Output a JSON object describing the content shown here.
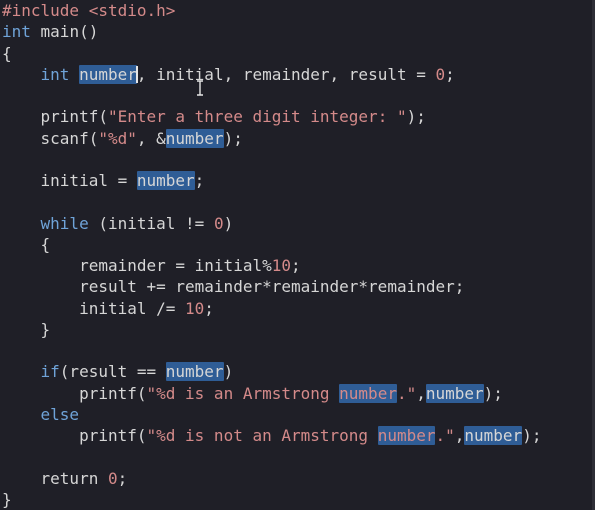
{
  "editor": {
    "colors": {
      "background": "#1f1f27",
      "text": "#d6d6d6",
      "keyword": "#6fa3d8",
      "literal": "#d48a8a",
      "highlight": "#2f5d96"
    },
    "mouse_cursor": "ibeam-cursor-icon",
    "lines": [
      [
        {
          "t": "#include <stdio.h>",
          "c": "pp"
        }
      ],
      [
        {
          "t": "int",
          "c": "kw"
        },
        {
          "t": " main()",
          "c": "pl"
        }
      ],
      [
        {
          "t": "{",
          "c": "pl"
        }
      ],
      [
        {
          "t": "    ",
          "c": "pl"
        },
        {
          "t": "int",
          "c": "kw"
        },
        {
          "t": " ",
          "c": "pl"
        },
        {
          "t": "number",
          "c": "pl",
          "hl": true
        },
        {
          "t": "",
          "c": "pl",
          "cursor": true
        },
        {
          "t": ", initial, remainder, result = ",
          "c": "pl"
        },
        {
          "t": "0",
          "c": "num"
        },
        {
          "t": ";",
          "c": "pl"
        }
      ],
      [],
      [
        {
          "t": "    printf(",
          "c": "pl"
        },
        {
          "t": "\"Enter a three digit integer: \"",
          "c": "str"
        },
        {
          "t": ");",
          "c": "pl"
        }
      ],
      [
        {
          "t": "    scanf(",
          "c": "pl"
        },
        {
          "t": "\"%d\"",
          "c": "str"
        },
        {
          "t": ", &",
          "c": "pl"
        },
        {
          "t": "number",
          "c": "pl",
          "hl": true
        },
        {
          "t": ");",
          "c": "pl"
        }
      ],
      [],
      [
        {
          "t": "    initial = ",
          "c": "pl"
        },
        {
          "t": "number",
          "c": "pl",
          "hl": true
        },
        {
          "t": ";",
          "c": "pl"
        }
      ],
      [],
      [
        {
          "t": "    ",
          "c": "pl"
        },
        {
          "t": "while",
          "c": "kw"
        },
        {
          "t": " (initial != ",
          "c": "pl"
        },
        {
          "t": "0",
          "c": "num"
        },
        {
          "t": ")",
          "c": "pl"
        }
      ],
      [
        {
          "t": "    {",
          "c": "pl"
        }
      ],
      [
        {
          "t": "        remainder = initial%",
          "c": "pl"
        },
        {
          "t": "10",
          "c": "num"
        },
        {
          "t": ";",
          "c": "pl"
        }
      ],
      [
        {
          "t": "        result += remainder*remainder*remainder;",
          "c": "pl"
        }
      ],
      [
        {
          "t": "        initial /= ",
          "c": "pl"
        },
        {
          "t": "10",
          "c": "num"
        },
        {
          "t": ";",
          "c": "pl"
        }
      ],
      [
        {
          "t": "    }",
          "c": "pl"
        }
      ],
      [],
      [
        {
          "t": "    ",
          "c": "pl"
        },
        {
          "t": "if",
          "c": "kw"
        },
        {
          "t": "(result == ",
          "c": "pl"
        },
        {
          "t": "number",
          "c": "pl",
          "hl": true
        },
        {
          "t": ")",
          "c": "pl"
        }
      ],
      [
        {
          "t": "        printf(",
          "c": "pl"
        },
        {
          "t": "\"%d is an Armstrong ",
          "c": "str"
        },
        {
          "t": "number",
          "c": "str",
          "hl": true
        },
        {
          "t": ".\"",
          "c": "str"
        },
        {
          "t": ",",
          "c": "pl"
        },
        {
          "t": "number",
          "c": "pl",
          "hl": true
        },
        {
          "t": ");",
          "c": "pl"
        }
      ],
      [
        {
          "t": "    ",
          "c": "pl"
        },
        {
          "t": "else",
          "c": "kw"
        }
      ],
      [
        {
          "t": "        printf(",
          "c": "pl"
        },
        {
          "t": "\"%d is not an Armstrong ",
          "c": "str"
        },
        {
          "t": "number",
          "c": "str",
          "hl": true
        },
        {
          "t": ".\"",
          "c": "str"
        },
        {
          "t": ",",
          "c": "pl"
        },
        {
          "t": "number",
          "c": "pl",
          "hl": true
        },
        {
          "t": ");",
          "c": "pl"
        }
      ],
      [],
      [
        {
          "t": "    return ",
          "c": "pl"
        },
        {
          "t": "0",
          "c": "num"
        },
        {
          "t": ";",
          "c": "pl"
        }
      ],
      [
        {
          "t": "}",
          "c": "pl"
        }
      ]
    ]
  }
}
